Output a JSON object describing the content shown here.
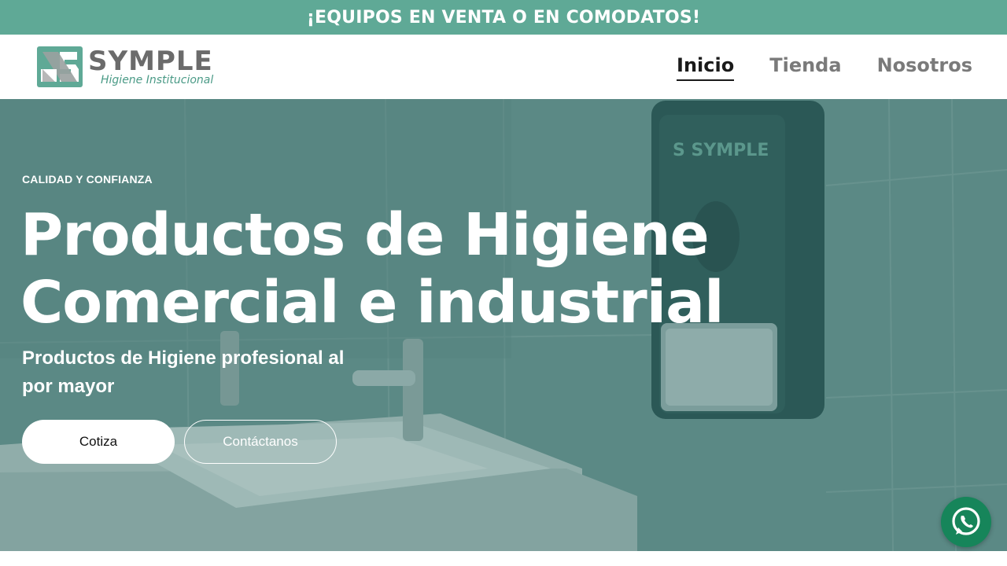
{
  "promo": {
    "text": "¡EQUIPOS EN VENTA O EN COMODATOS!"
  },
  "brand": {
    "name": "SYMPLE",
    "tagline": "Higiene Institucional",
    "color_primary": "#5fa996",
    "color_dark": "#6b6b6b"
  },
  "nav": {
    "items": [
      {
        "label": "Inicio",
        "active": true
      },
      {
        "label": "Tienda",
        "active": false
      },
      {
        "label": "Nosotros",
        "active": false
      }
    ]
  },
  "hero": {
    "eyebrow": "CALIDAD Y CONFIANZA",
    "title_line1": "Productos de Higiene",
    "title_line2": "Comercial e industrial",
    "subtitle": "Productos de Higiene profesional al por mayor",
    "cta_primary": "Cotiza",
    "cta_secondary": "Contáctanos",
    "dispenser_brand": "SYMPLE"
  },
  "floating": {
    "icon": "whatsapp-icon",
    "color": "#16855a"
  }
}
